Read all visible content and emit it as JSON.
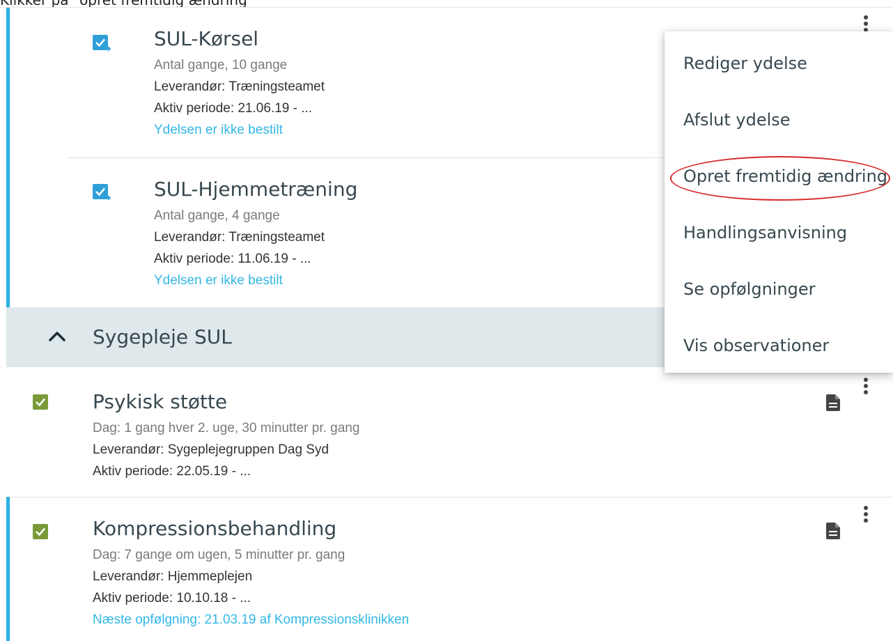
{
  "caption": "Klikker på \"opret fremtidig ændring\"",
  "services": [
    {
      "title": "SUL-Kørsel",
      "line1": "Antal gange, 10 gange",
      "supplier": "Leverandør:  Træningsteamet",
      "period": "Aktiv periode:  21.06.19  -  ...",
      "status": "Ydelsen er ikke bestilt"
    },
    {
      "title": "SUL-Hjemmetræning",
      "line1": "Antal gange, 4 gange",
      "supplier": "Leverandør:  Træningsteamet",
      "period": "Aktiv periode:  11.06.19  -  ...",
      "status": "Ydelsen er ikke bestilt"
    }
  ],
  "section": {
    "title": "Sygepleje SUL",
    "icon": "chevron-up-icon"
  },
  "psykisk": {
    "title": "Psykisk støtte",
    "line1": "Dag: 1 gang hver 2. uge, 30 minutter pr. gang",
    "supplier": "Leverandør:  Sygeplejegruppen Dag Syd",
    "period": "Aktiv periode:  22.05.19  -  ..."
  },
  "kompression": {
    "title": "Kompressionsbehandling",
    "line1": "Dag: 7 gange om ugen, 5 minutter pr. gang",
    "supplier": "Leverandør:  Hjemmeplejen",
    "period": "Aktiv periode:  10.10.18  -  ...",
    "followup": "Næste opfølgning:  21.03.19  af  Kompressionsklinikken"
  },
  "menu": {
    "items": [
      "Rediger ydelse",
      "Afslut ydelse",
      "Opret fremtidig ændring",
      "Handlingsanvisning",
      "Se opfølgninger",
      "Vis observationer"
    ],
    "highlighted_index": 2
  },
  "colors": {
    "accent": "#2bb1e6",
    "link": "#33b7e6",
    "checkbox_blue": "#2f9fd8",
    "checkbox_green": "#7a9a3a",
    "section_bg": "#dfe8eb",
    "highlight": "#d82a2a"
  }
}
